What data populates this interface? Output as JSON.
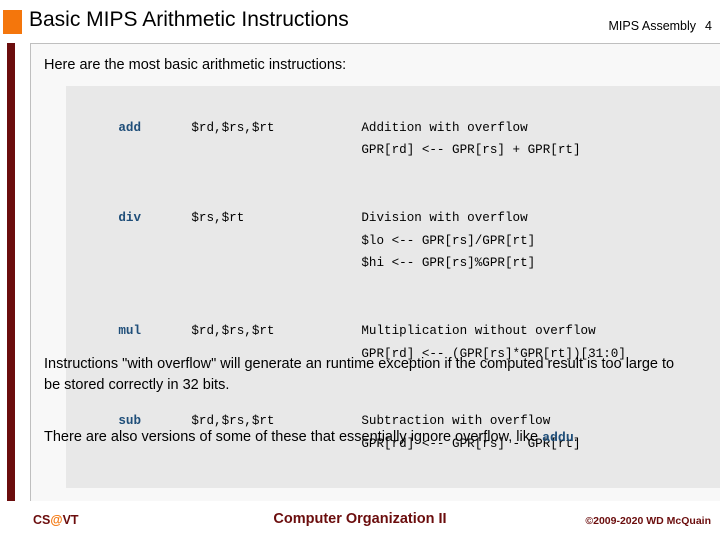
{
  "header": {
    "title": "Basic MIPS Arithmetic Instructions",
    "section": "MIPS Assembly",
    "slide_number": "4",
    "bullet_color": "#f4760c"
  },
  "body": {
    "intro": "Here are the most basic arithmetic instructions:",
    "table": {
      "rows": [
        {
          "mnemonic": "add",
          "operands": "$rd,$rs,$rt",
          "description": [
            "Addition with overflow",
            "GPR[rd] <-- GPR[rs] + GPR[rt]"
          ]
        },
        {
          "mnemonic": "div",
          "operands": "$rs,$rt",
          "description": [
            "Division with overflow",
            "$lo <-- GPR[rs]/GPR[rt]",
            "$hi <-- GPR[rs]%GPR[rt]"
          ]
        },
        {
          "mnemonic": "mul",
          "operands": "$rd,$rs,$rt",
          "description": [
            "Multiplication without overflow",
            "GPR[rd] <-- (GPR[rs]*GPR[rt])[31:0]"
          ]
        },
        {
          "mnemonic": "sub",
          "operands": "$rd,$rs,$rt",
          "description": [
            "Subtraction with overflow",
            "GPR[rd] <-- GPR[rs] - GPR[rt]"
          ]
        }
      ]
    },
    "paragraph_1": "Instructions \"with overflow\" will generate an runtime exception if the computed result is too large to be stored correctly in 32 bits.",
    "paragraph_2_prefix": "There are also versions of some of these that essentially ignore overflow, like ",
    "paragraph_2_code": "addu",
    "paragraph_2_suffix": "."
  },
  "footer": {
    "logo_left": "CS",
    "logo_at": "@",
    "logo_right": "VT",
    "center": "Computer Organization II",
    "copyright": "©2009-2020 WD McQuain",
    "accent_color": "#6b0d0d"
  }
}
